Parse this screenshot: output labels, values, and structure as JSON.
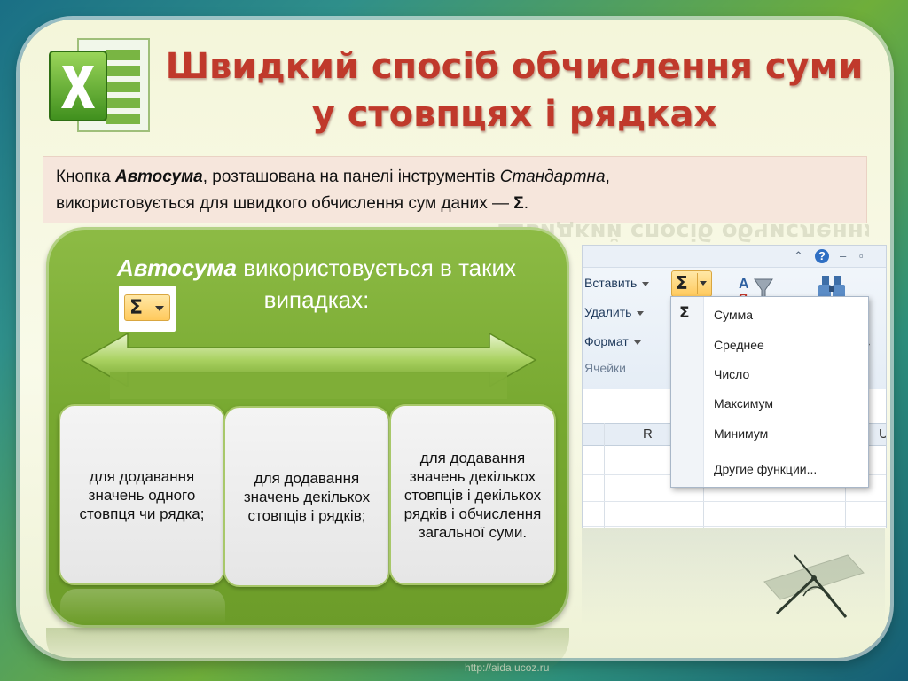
{
  "title": {
    "line1": "Швидкий спосіб обчислення суми",
    "line2": "у стовпцях і рядках"
  },
  "intro": {
    "part1": "Кнопка ",
    "autosum": "Автосума",
    "part2": ", розташована на панелі інструментів ",
    "standard": "Стандартна",
    "part3": ",",
    "part4": "використовується для швидкого обчислення сум даних — ",
    "sigma": "Σ",
    "part5": "."
  },
  "panel": {
    "heading_bold": "Автосума",
    "heading_rest": " використовується в таких випадках:",
    "sigma_symbol": "Σ",
    "cards": [
      "для додавання значень одного стовпця чи рядка;",
      "для додавання значень декількох стовпців і рядків;",
      "для додавання значень декількох стовпців і декількох рядків і обчислення загальної суми."
    ]
  },
  "excel": {
    "ribbon_items": [
      "Вставить",
      "Удалить",
      "Формат"
    ],
    "group_label": "Ячейки",
    "column_header": "R",
    "sigma_symbol": "Σ",
    "menu_sigma": "Σ",
    "menu_items": [
      "Сумма",
      "Среднее",
      "Число",
      "Максимум",
      "Минимум",
      "Другие функции..."
    ]
  },
  "footer": {
    "url": "http://aida.ucoz.ru"
  }
}
